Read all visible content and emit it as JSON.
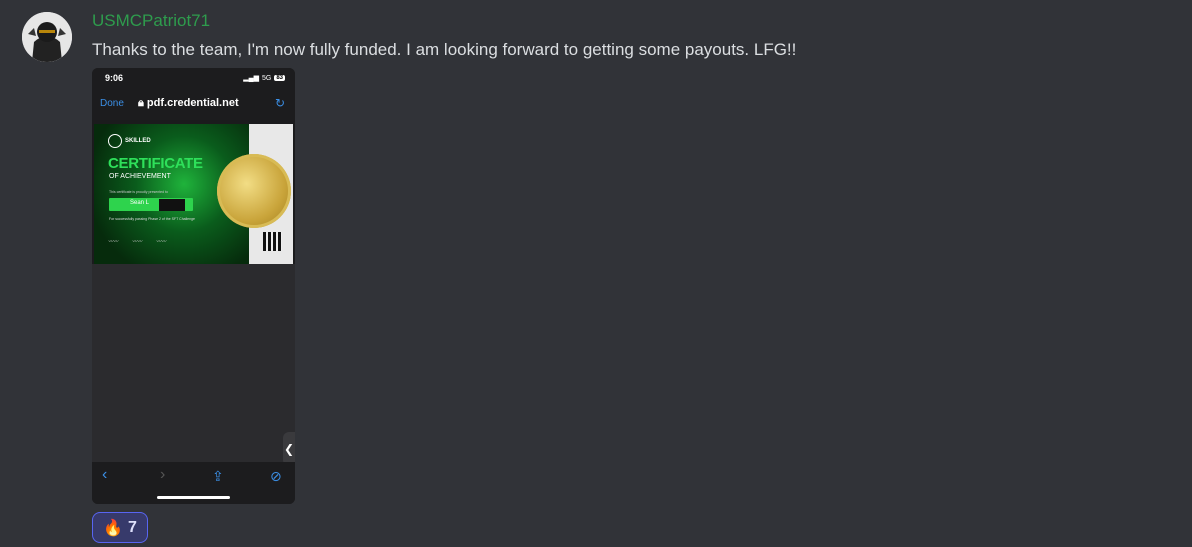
{
  "message": {
    "username": "USMCPatriot71",
    "username_color": "#2e9c4d",
    "text": "Thanks to the team, I'm now fully funded. I am looking forward to getting some payouts. LFG!!",
    "avatar_icon": "helmet-avatar-icon"
  },
  "attachment": {
    "status_time": "9:06",
    "status_network": "5G",
    "status_battery": "83",
    "done_label": "Done",
    "url": "pdf.credential.net",
    "certificate": {
      "brand": "SKILLED",
      "title": "CERTIFICATE",
      "subtitle": "OF ACHIEVEMENT",
      "presented_text": "This certificate is proudly presented to",
      "recipient": "Sean L",
      "phase_text": "For successfully passing Phase 2 of the SFT Challenge"
    }
  },
  "reaction": {
    "emoji": "🔥",
    "count": "7",
    "accent": "#5865f2"
  }
}
